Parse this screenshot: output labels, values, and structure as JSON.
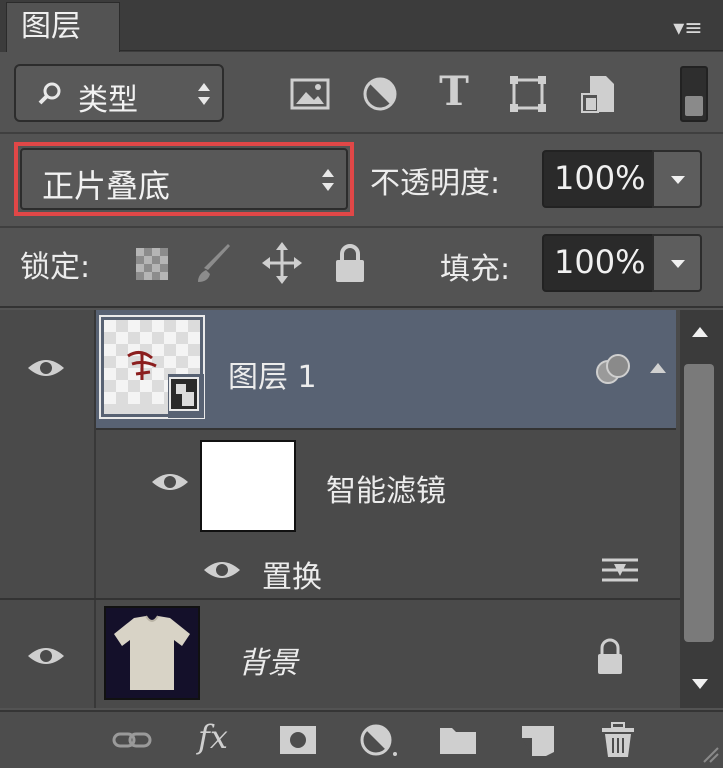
{
  "panel": {
    "tab_label": "图层",
    "menu_icon": "panel-menu-icon",
    "menu_glyph": "▾≡"
  },
  "filter": {
    "kind_label": "类型",
    "icons": [
      "image-filter-icon",
      "adjustment-filter-icon",
      "type-filter-icon",
      "shape-filter-icon",
      "smart-object-filter-icon"
    ],
    "type_glyph": "T"
  },
  "blend": {
    "mode": "正片叠底",
    "opacity_label": "不透明度:",
    "opacity_value": "100%"
  },
  "lock": {
    "label": "锁定:",
    "icons": [
      "lock-transparent-icon",
      "lock-image-icon",
      "lock-position-icon",
      "lock-all-icon"
    ],
    "fill_label": "填充:",
    "fill_value": "100%"
  },
  "layers": [
    {
      "name": "图层 1",
      "selected": true,
      "visible": true,
      "type": "smart-object"
    },
    {
      "name": "智能滤镜",
      "visible": true,
      "type": "smart-filter-mask"
    },
    {
      "name": "置换",
      "visible": true,
      "type": "filter"
    },
    {
      "name": "背景",
      "visible": true,
      "locked": true,
      "type": "background"
    }
  ],
  "bottom_bar": {
    "icons": [
      "link-layers-icon",
      "fx-icon",
      "add-mask-icon",
      "new-adjustment-icon",
      "new-group-icon",
      "new-layer-icon",
      "delete-icon"
    ],
    "fx_text": "fx"
  },
  "colors": {
    "selected_row": "#586273",
    "highlight_border": "#e04747",
    "panel_bg": "#535353"
  }
}
